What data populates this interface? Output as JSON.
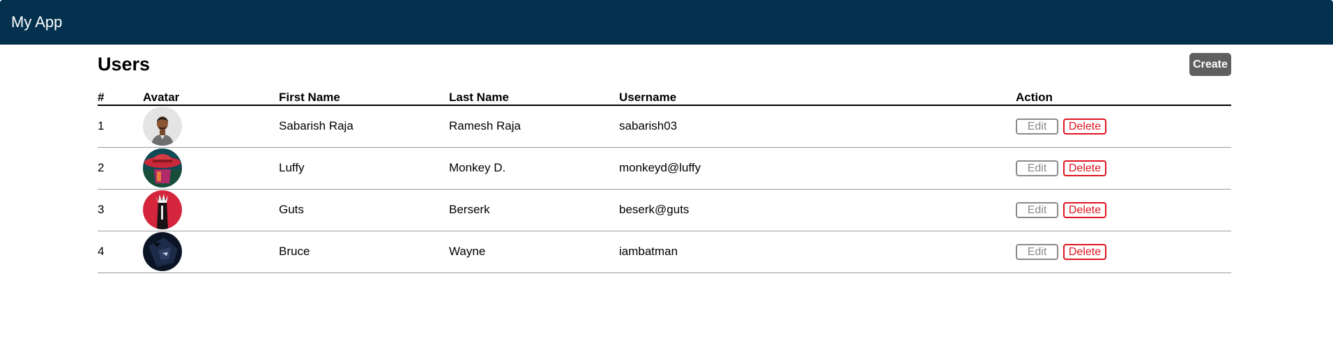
{
  "navbar": {
    "brand": "My App"
  },
  "page": {
    "title": "Users",
    "create_label": "Create"
  },
  "table": {
    "headers": {
      "num": "#",
      "avatar": "Avatar",
      "first": "First Name",
      "last": "Last Name",
      "username": "Username",
      "action": "Action"
    },
    "rows": [
      {
        "num": "1",
        "avatar_icon": "person-photo-avatar",
        "first": "Sabarish Raja",
        "last": "Ramesh Raja",
        "username": "sabarish03"
      },
      {
        "num": "2",
        "avatar_icon": "straw-hat-avatar",
        "first": "Luffy",
        "last": "Monkey D.",
        "username": "monkeyd@luffy"
      },
      {
        "num": "3",
        "avatar_icon": "swordsman-avatar",
        "first": "Guts",
        "last": "Berserk",
        "username": "beserk@guts"
      },
      {
        "num": "4",
        "avatar_icon": "batman-avatar",
        "first": "Bruce",
        "last": "Wayne",
        "username": "iambatman"
      }
    ],
    "actions": {
      "edit_label": "Edit",
      "delete_label": "Delete"
    }
  },
  "colors": {
    "navbar": "#03304d",
    "create_button": "#5f5f5f",
    "delete": "#e0131e",
    "edit": "#8a8a8a"
  }
}
